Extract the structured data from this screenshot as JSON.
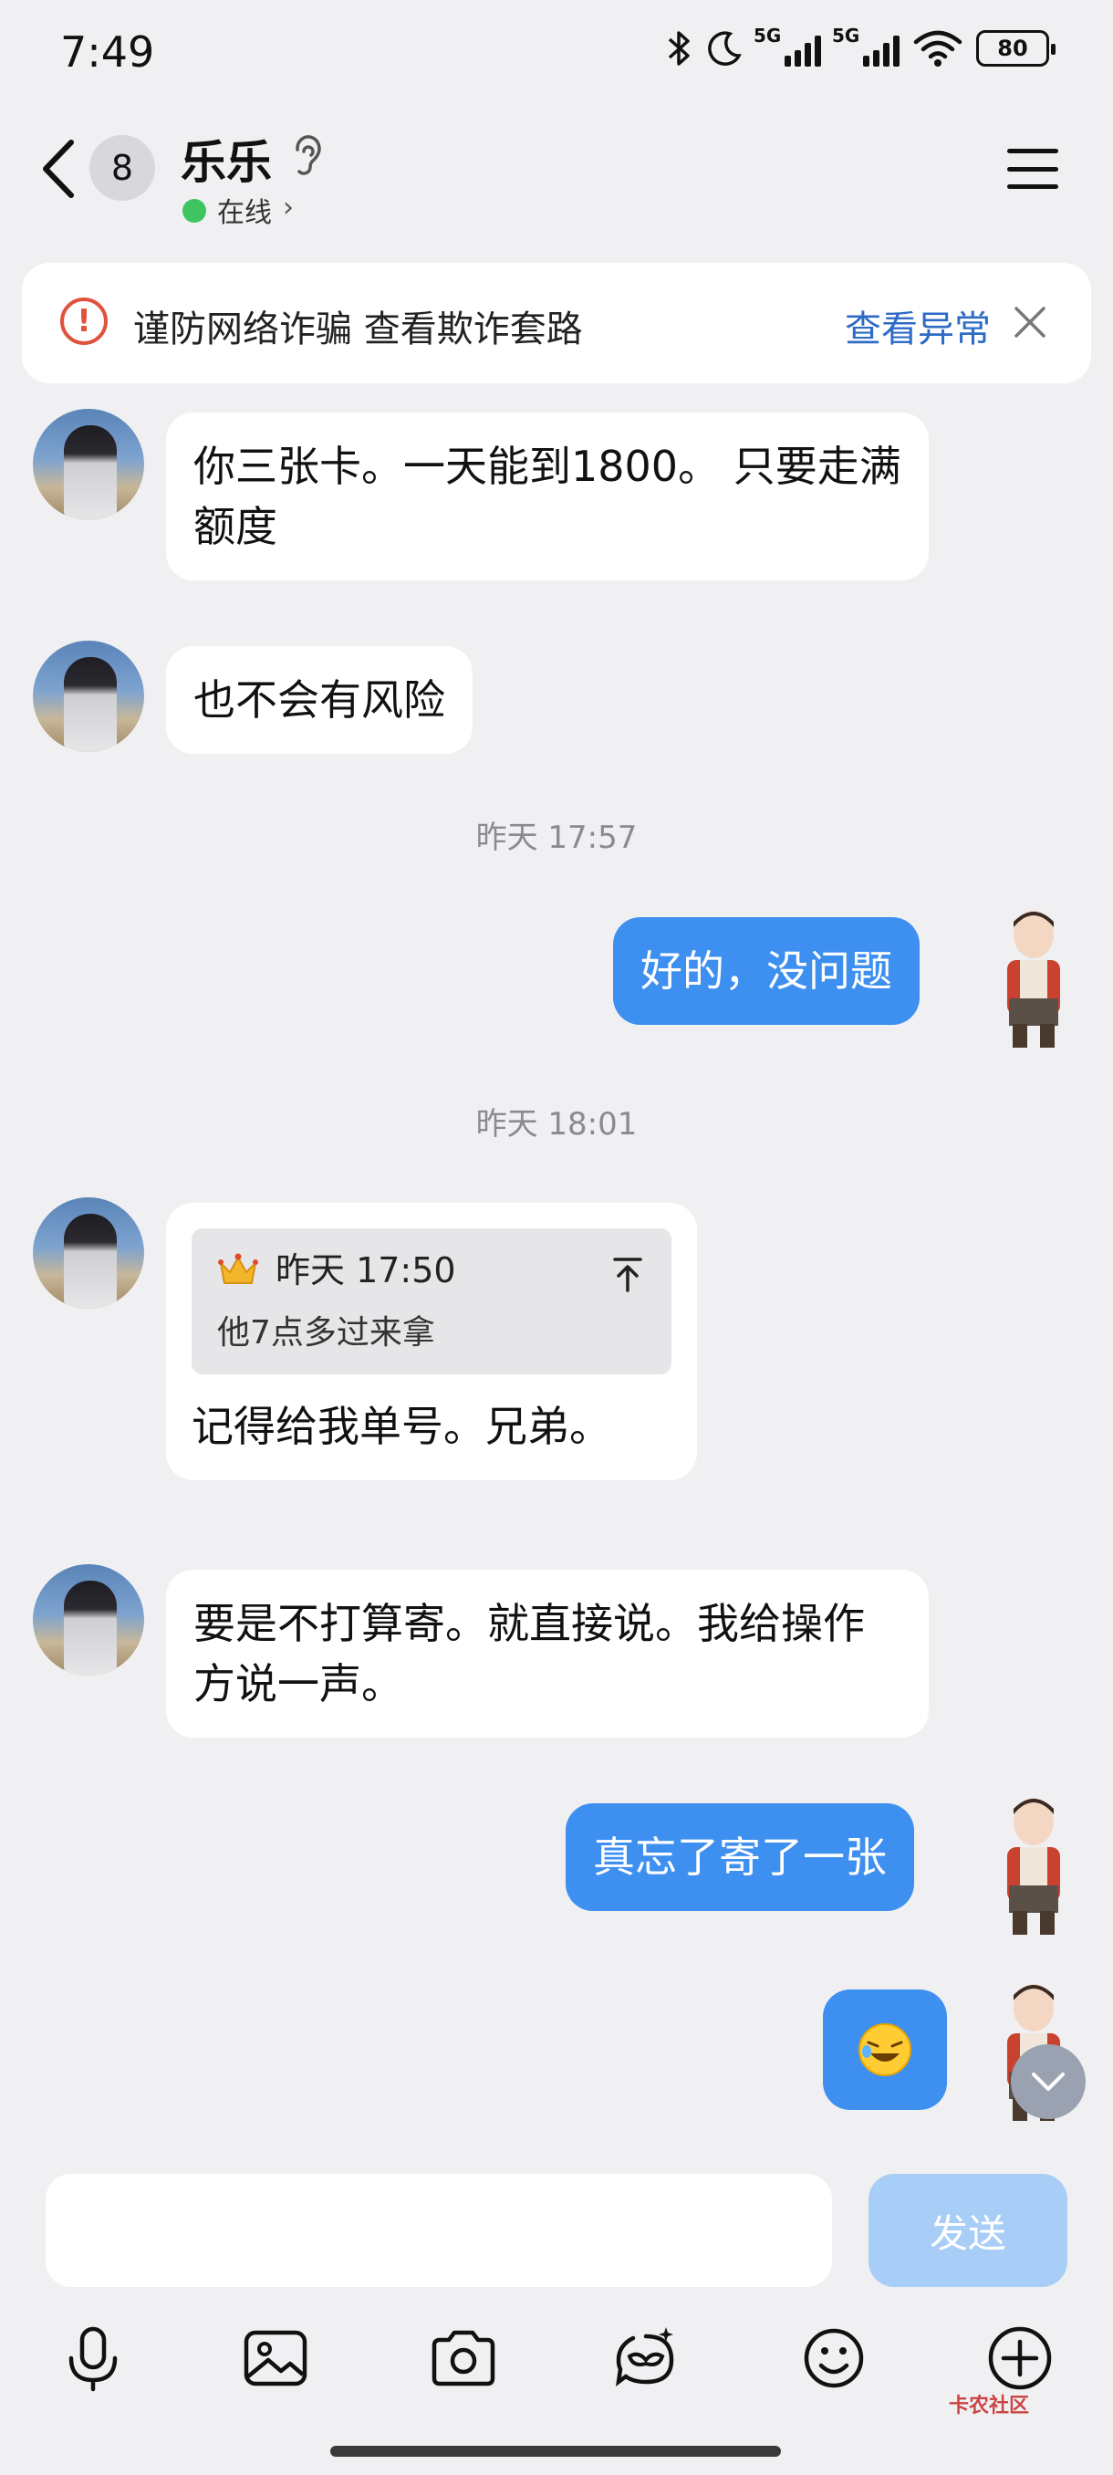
{
  "status_bar": {
    "time": "7:49",
    "battery": "80",
    "network_label": "5G"
  },
  "header": {
    "unread_count": "8",
    "contact_name": "乐乐",
    "presence": "在线"
  },
  "warning_banner": {
    "text": "谨防网络诈骗 查看欺诈套路",
    "link": "查看异常"
  },
  "messages": {
    "m1": "你三张卡。一天能到1800。 只要走满额度",
    "m2": "也不会有风险",
    "ts1": "昨天 17:57",
    "m3": "好的，没问题",
    "ts2": "昨天 18:01",
    "quote_time": "昨天 17:50",
    "quote_text": "他7点多过来拿",
    "m4": "记得给我单号。兄弟。",
    "m5": "要是不打算寄。就直接说。我给操作方说一声。",
    "m6": "真忘了寄了一张"
  },
  "composer": {
    "send_label": "发送",
    "placeholder": ""
  },
  "watermark": "卡农社区",
  "colors": {
    "accent": "#3d8ff0",
    "warning": "#e0523c",
    "link": "#2d6bc4",
    "online": "#3ec55f"
  }
}
